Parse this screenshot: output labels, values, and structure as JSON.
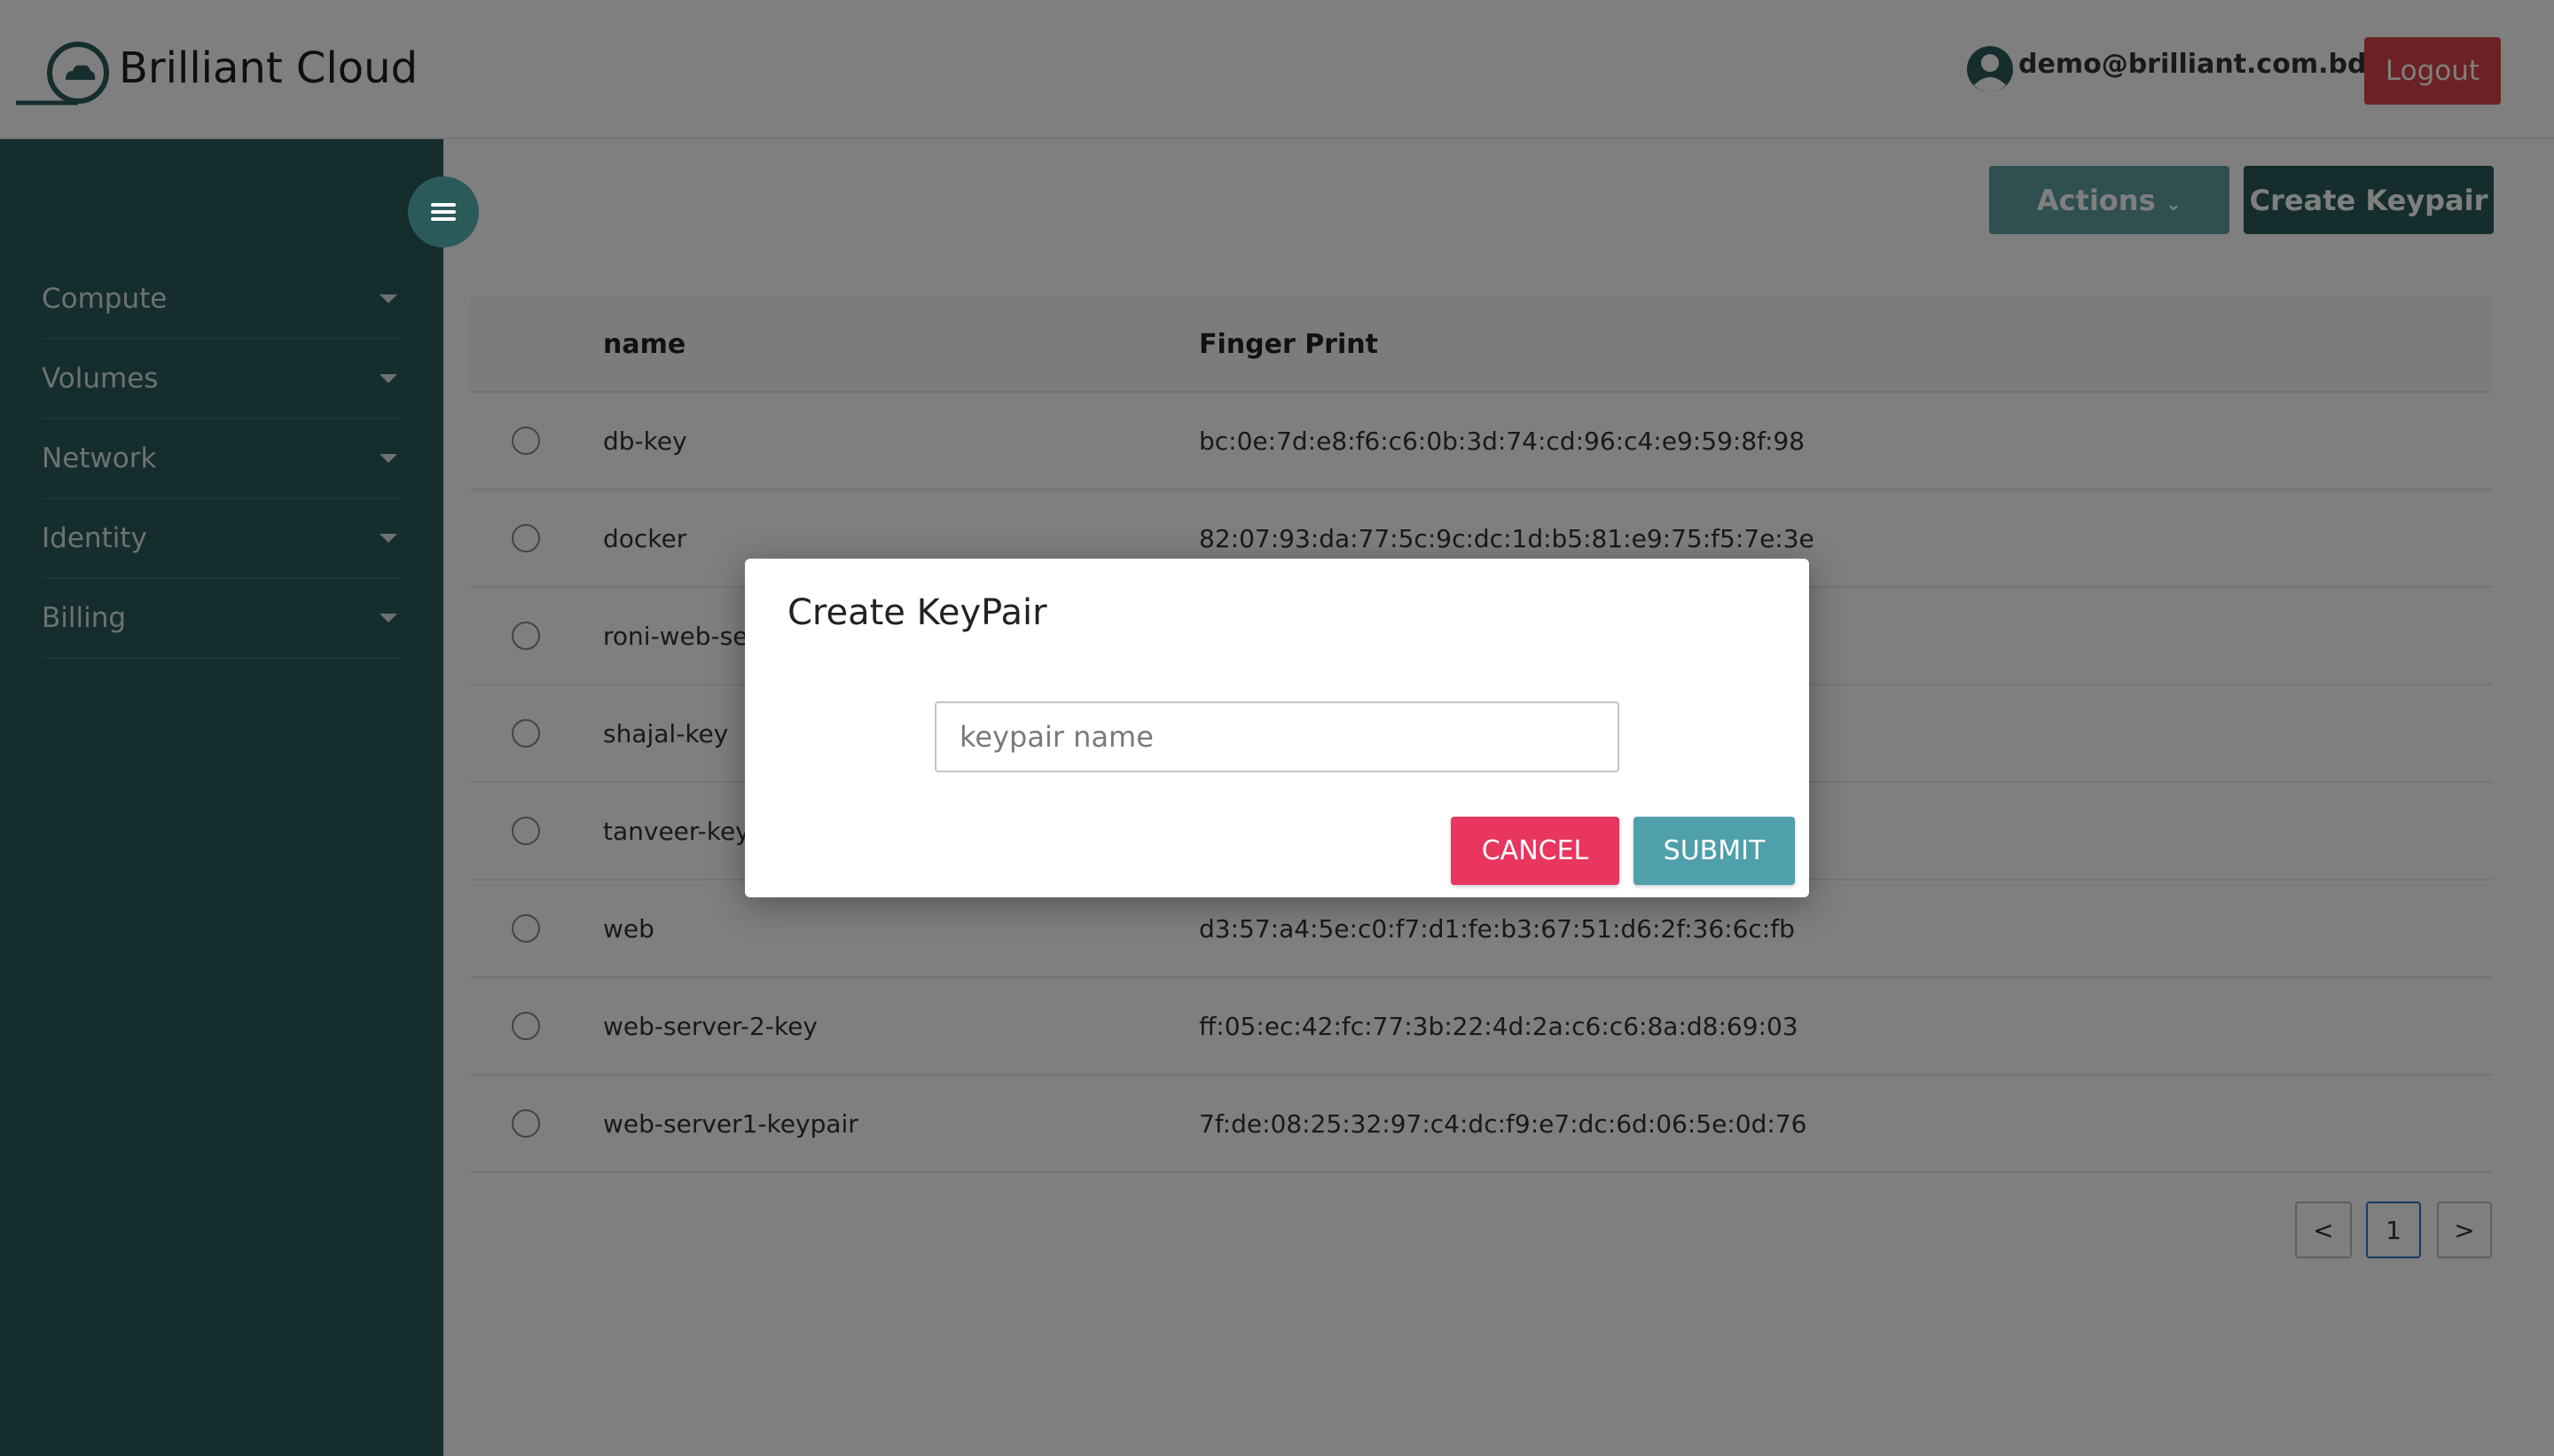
{
  "app": {
    "name": "Brilliant Cloud"
  },
  "header": {
    "user_email": "demo@brilliant.com.bd",
    "logout_label": "Logout"
  },
  "sidebar": {
    "items": [
      {
        "label": "Compute"
      },
      {
        "label": "Volumes"
      },
      {
        "label": "Network"
      },
      {
        "label": "Identity"
      },
      {
        "label": "Billing"
      }
    ]
  },
  "toolbar": {
    "actions_label": "Actions",
    "create_label": "Create Keypair"
  },
  "table": {
    "columns": [
      "name",
      "Finger Print"
    ],
    "rows": [
      {
        "name": "db-key",
        "fingerprint": "bc:0e:7d:e8:f6:c6:0b:3d:74:cd:96:c4:e9:59:8f:98"
      },
      {
        "name": "docker",
        "fingerprint": "82:07:93:da:77:5c:9c:dc:1d:b5:81:e9:75:f5:7e:3e"
      },
      {
        "name": "roni-web-se",
        "fingerprint": ""
      },
      {
        "name": "shajal-key",
        "fingerprint": ""
      },
      {
        "name": "tanveer-key",
        "fingerprint": ""
      },
      {
        "name": "web",
        "fingerprint": "d3:57:a4:5e:c0:f7:d1:fe:b3:67:51:d6:2f:36:6c:fb"
      },
      {
        "name": "web-server-2-key",
        "fingerprint": "ff:05:ec:42:fc:77:3b:22:4d:2a:c6:c6:8a:d8:69:03"
      },
      {
        "name": "web-server1-keypair",
        "fingerprint": "7f:de:08:25:32:97:c4:dc:f9:e7:dc:6d:06:5e:0d:76"
      }
    ]
  },
  "pagination": {
    "prev": "<",
    "current": "1",
    "next": ">"
  },
  "modal": {
    "title": "Create KeyPair",
    "input_placeholder": "keypair name",
    "input_value": "",
    "cancel_label": "CANCEL",
    "submit_label": "SUBMIT"
  },
  "colors": {
    "sidebar": "#2b5a5a",
    "logout": "#d9424a",
    "cancel": "#e8365f",
    "submit": "#4fa0aa",
    "actions": "#5f9ea0"
  }
}
